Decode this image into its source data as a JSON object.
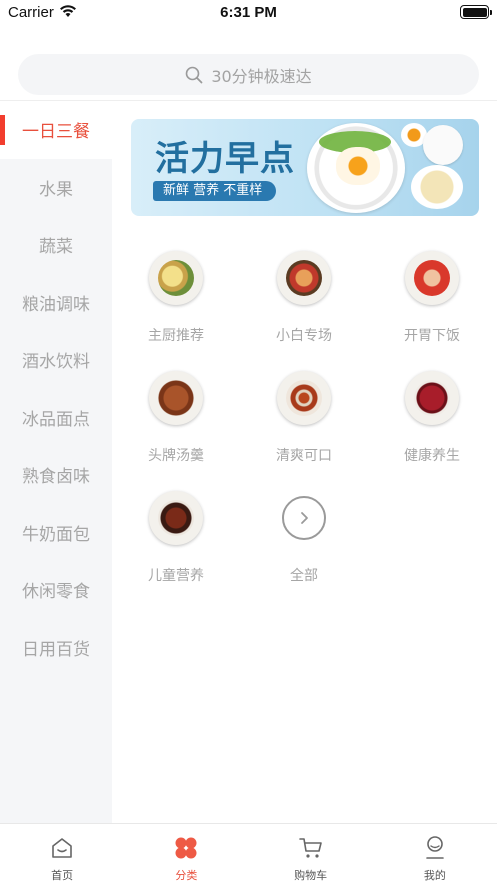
{
  "status_bar": {
    "carrier": "Carrier",
    "time": "6:31 PM"
  },
  "search": {
    "placeholder": "30分钟极速达",
    "icon": "search-icon"
  },
  "sidebar": {
    "items": [
      {
        "label": "一日三餐",
        "active": true
      },
      {
        "label": "水果"
      },
      {
        "label": "蔬菜"
      },
      {
        "label": "粮油调味"
      },
      {
        "label": "酒水饮料"
      },
      {
        "label": "冰品面点"
      },
      {
        "label": "熟食卤味"
      },
      {
        "label": "牛奶面包"
      },
      {
        "label": "休闲零食"
      },
      {
        "label": "日用百货"
      }
    ]
  },
  "banner": {
    "title": "活力早点",
    "tagline": "新鲜 营养 不重样"
  },
  "categories": [
    {
      "label": "主厨推荐"
    },
    {
      "label": "小白专场"
    },
    {
      "label": "开胃下饭"
    },
    {
      "label": "头牌汤羹"
    },
    {
      "label": "清爽可口"
    },
    {
      "label": "健康养生"
    },
    {
      "label": "儿童营养"
    },
    {
      "label": "全部"
    }
  ],
  "tabbar": {
    "tabs": [
      {
        "label": "首页",
        "icon": "home-icon"
      },
      {
        "label": "分类",
        "icon": "category-icon",
        "active": true
      },
      {
        "label": "购物车",
        "icon": "cart-icon"
      },
      {
        "label": "我的",
        "icon": "profile-icon"
      }
    ]
  },
  "colors": {
    "accent": "#e8503d",
    "sidebar_bg": "#f5f6f8",
    "muted_text": "#a6a6a6"
  }
}
